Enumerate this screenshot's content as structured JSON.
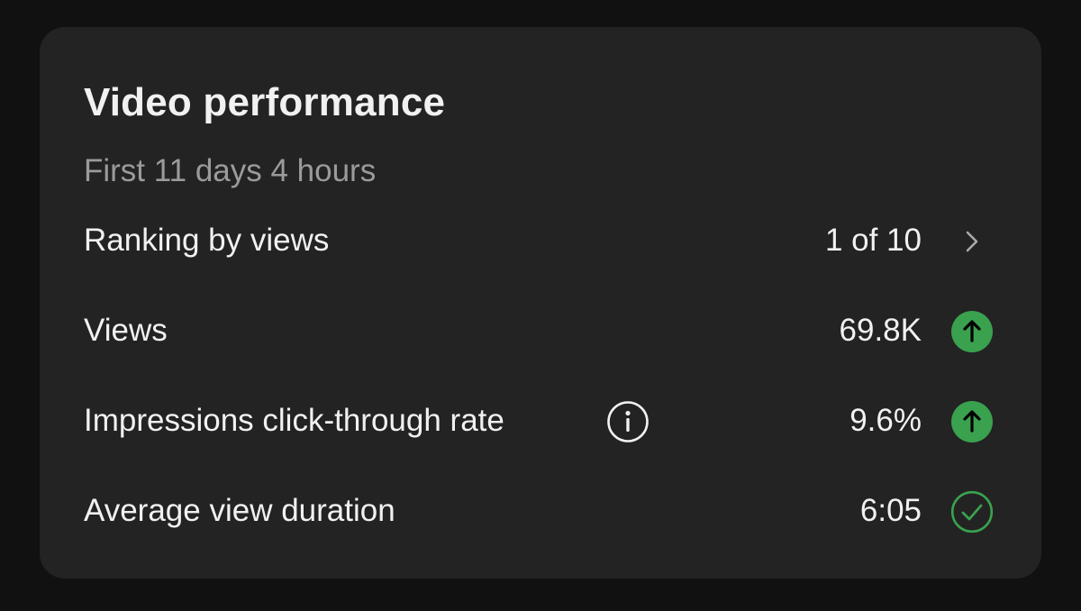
{
  "card": {
    "title": "Video performance",
    "subtitle": "First 11 days 4 hours"
  },
  "metrics": [
    {
      "label": "Ranking by views",
      "value": "1 of 10",
      "indicator": "chevron-right-icon"
    },
    {
      "label": "Views",
      "value": "69.8K",
      "indicator": "arrow-up-icon"
    },
    {
      "label": "Impressions click-through rate",
      "value": "9.6%",
      "indicator": "arrow-up-icon",
      "info": "info-icon"
    },
    {
      "label": "Average view duration",
      "value": "6:05",
      "indicator": "checkmark-circle-icon"
    }
  ],
  "colors": {
    "background": "#111111",
    "card": "#232323",
    "text_primary": "#f1f1f1",
    "text_secondary": "#9b9b9b",
    "positive": "#3aa14f",
    "chevron": "#aaaaaa"
  }
}
